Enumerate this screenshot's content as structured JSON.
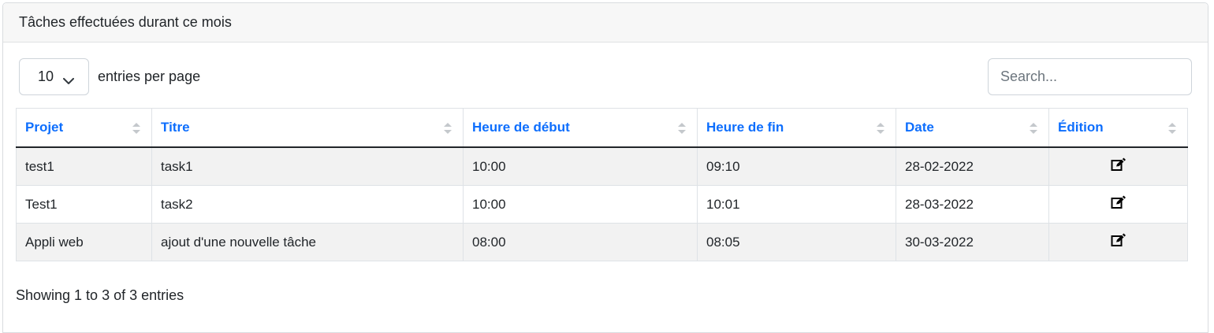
{
  "card": {
    "title": "Tâches effectuées durant ce mois"
  },
  "controls": {
    "per_page_value": "10",
    "per_page_label": "entries per page",
    "search_placeholder": "Search..."
  },
  "table": {
    "headers": [
      "Projet",
      "Titre",
      "Heure de début",
      "Heure de fin",
      "Date",
      "Édition"
    ],
    "rows": [
      {
        "projet": "test1",
        "titre": "task1",
        "debut": "10:00",
        "fin": "09:10",
        "date": "28-02-2022",
        "edit_icon": "edit-icon"
      },
      {
        "projet": "Test1",
        "titre": "task2",
        "debut": "10:00",
        "fin": "10:01",
        "date": "28-03-2022",
        "edit_icon": "edit-icon"
      },
      {
        "projet": "Appli web",
        "titre": "ajout d'une nouvelle tâche",
        "debut": "08:00",
        "fin": "08:05",
        "date": "30-03-2022",
        "edit_icon": "edit-icon"
      }
    ]
  },
  "footer": {
    "info": "Showing 1 to 3 of 3 entries"
  },
  "colors": {
    "header_link": "#0d6efd",
    "stripe": "#f2f2f2",
    "card_header_bg": "#f7f7f7"
  }
}
